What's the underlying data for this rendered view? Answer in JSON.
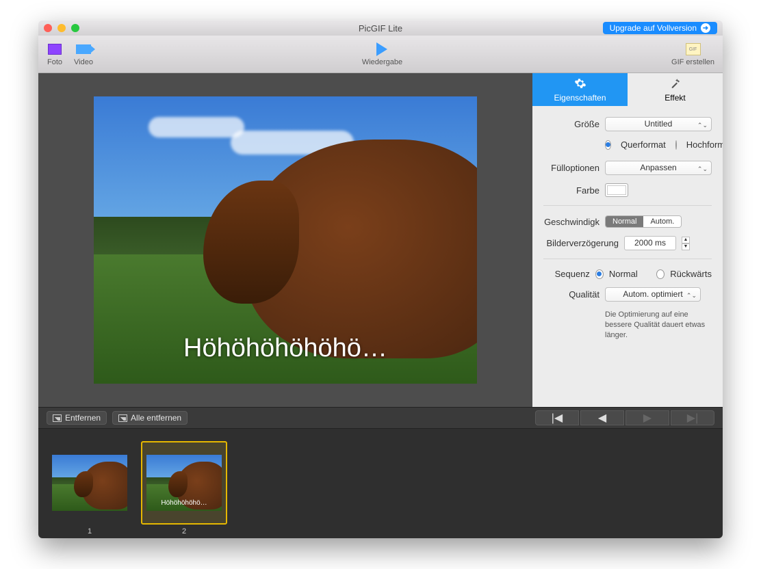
{
  "window": {
    "title": "PicGIF Lite"
  },
  "upgrade": {
    "label": "Upgrade auf Vollversion"
  },
  "toolbar": {
    "foto": "Foto",
    "video": "Video",
    "wiedergabe": "Wiedergabe",
    "gif_erstellen": "GIF erstellen",
    "gif_badge": "GIF"
  },
  "preview": {
    "caption": "Höhöhöhöhöhö…"
  },
  "tabs": {
    "properties": "Eigenschaften",
    "effect": "Effekt"
  },
  "panel": {
    "size_label": "Größe",
    "size_value": "Untitled",
    "landscape": "Querformat",
    "portrait": "Hochformat",
    "fill_label": "Fülloptionen",
    "fill_value": "Anpassen",
    "color_label": "Farbe",
    "speed_label": "Geschwindigk",
    "speed_normal": "Normal",
    "speed_auto": "Autom.",
    "delay_label": "Bilderverzögerung",
    "delay_value": "2000 ms",
    "sequence_label": "Sequenz",
    "sequence_normal": "Normal",
    "sequence_reverse": "Rückwärts",
    "quality_label": "Qualität",
    "quality_value": "Autom. optimiert",
    "quality_hint": "Die Optimierung auf eine bessere Qualität dauert etwas länger."
  },
  "strip": {
    "remove": "Entfernen",
    "remove_all": "Alle entfernen"
  },
  "thumbs": [
    {
      "num": "1",
      "caption": "",
      "selected": false
    },
    {
      "num": "2",
      "caption": "Höhöhöhöhö…",
      "selected": true
    }
  ]
}
